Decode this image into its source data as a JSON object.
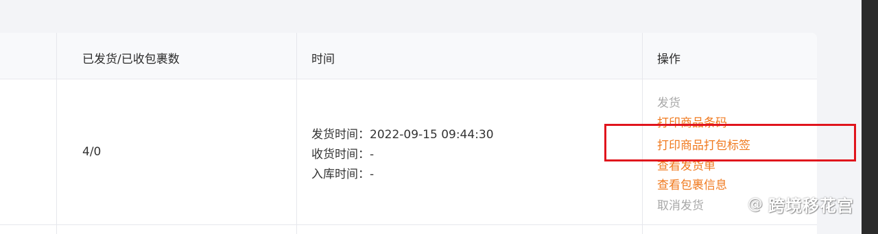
{
  "table": {
    "headers": {
      "shipped_received": "已发货/已收包裹数",
      "time": "时间",
      "actions": "操作"
    },
    "row": {
      "count": "4/0",
      "time_lines": [
        "发货时间：2022-09-15 09:44:30",
        "收货时间：-",
        "入库时间：-"
      ],
      "actions": [
        "发货",
        "打印商品条码",
        "打印商品打包标签",
        "查看发货单",
        "查看包裹信息",
        "取消发货"
      ]
    }
  },
  "watermark": {
    "at": "@",
    "name": "跨境移花宫",
    "icon": "wechat-bubble-icon"
  },
  "colors": {
    "action_orange": "#f07a1f",
    "action_grey": "#a8a8a8",
    "highlight_red": "#e0141c",
    "header_bg": "#f8f9fb"
  }
}
